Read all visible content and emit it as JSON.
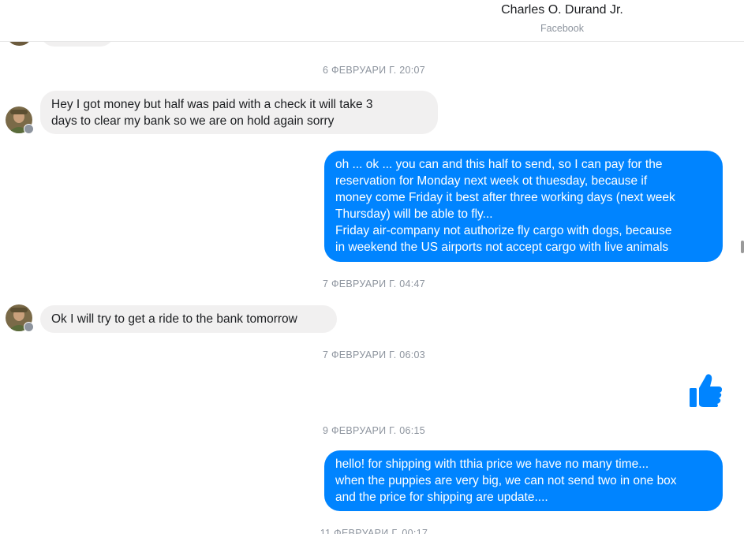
{
  "header": {
    "contact_name": "Charles O. Durand Jr.",
    "source": "Facebook"
  },
  "messages": [
    {
      "kind": "timestamp",
      "text": "6 ФЕВРУАРИ Г. 20:07"
    },
    {
      "kind": "incoming",
      "text": "Hey I got money but half was paid with a check it will take 3\ndays to clear my bank so we are on hold again sorry"
    },
    {
      "kind": "outgoing",
      "text": "oh ... ok ... you can and this half to send, so I can pay for the\nreservation for Monday next week ot thuesday, because if\nmoney come Friday it best after three working days (next week\nThursday) will be able to fly...\nFriday air-company not authorize fly cargo with dogs, because\nin weekend the US airports not accept cargo with live animals"
    },
    {
      "kind": "timestamp",
      "text": "7 ФЕВРУАРИ Г. 04:47"
    },
    {
      "kind": "incoming",
      "text": "Ok I will try to get a ride to the bank tomorrow"
    },
    {
      "kind": "timestamp",
      "text": "7 ФЕВРУАРИ Г. 06:03"
    },
    {
      "kind": "like",
      "icon": "thumbs-up-icon"
    },
    {
      "kind": "timestamp",
      "text": "9 ФЕВРУАРИ Г. 06:15"
    },
    {
      "kind": "outgoing",
      "text": "hello! for shipping with tthia price we have no many time...\nwhen the puppies are very big, we can not send two in one box\nand the price for shipping are update...."
    },
    {
      "kind": "timestamp",
      "text": "11 ФЕВРУАРИ Г. 00:17"
    }
  ],
  "colors": {
    "outgoing_bubble": "#0084ff",
    "incoming_bubble": "#f1f0f0",
    "timestamp_text": "#8d949e"
  }
}
